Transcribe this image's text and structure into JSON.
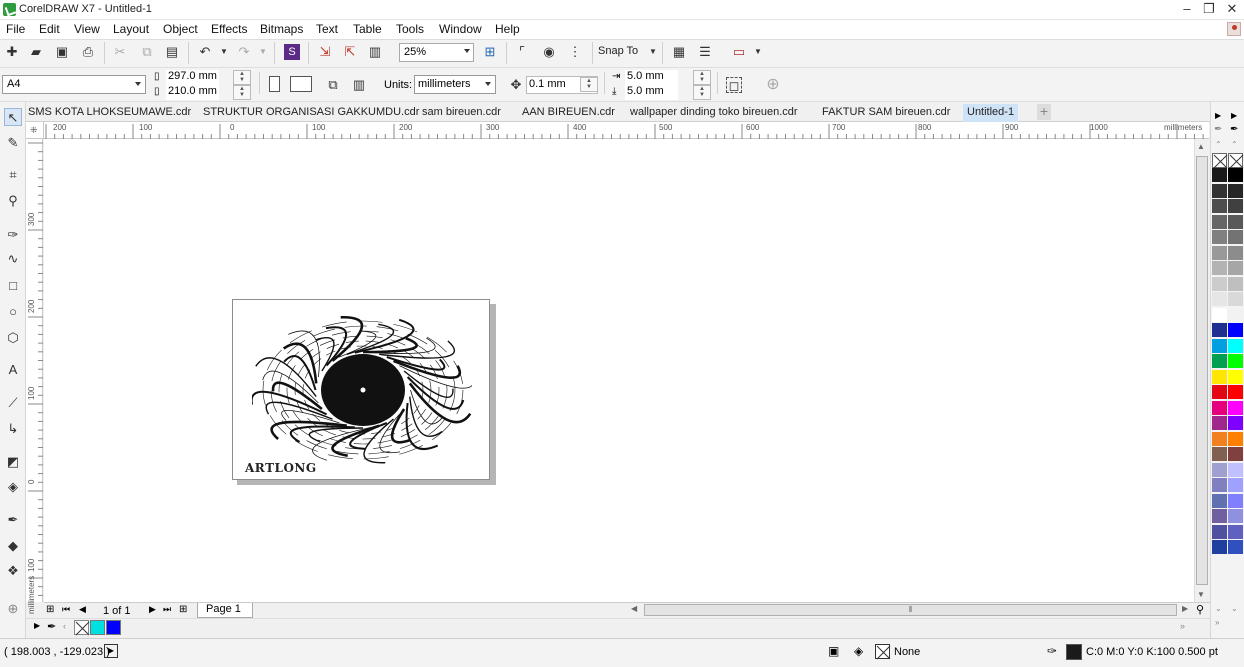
{
  "window": {
    "title": "CorelDRAW X7 - Untitled-1",
    "minimize": "–",
    "maximize": "❐",
    "close": "✕"
  },
  "menu": [
    "File",
    "Edit",
    "View",
    "Layout",
    "Object",
    "Effects",
    "Bitmaps",
    "Text",
    "Table",
    "Tools",
    "Window",
    "Help"
  ],
  "toolbar": {
    "zoom": "25%",
    "snap_to": "Snap To"
  },
  "property_bar": {
    "paper": "A4",
    "width": "297.0 mm",
    "height": "210.0 mm",
    "units_label": "Units:",
    "units": "millimeters",
    "nudge": "0.1 mm",
    "dup_x": "5.0 mm",
    "dup_y": "5.0 mm"
  },
  "tabs": [
    "SMS KOTA LHOKSEUMAWE.cdr",
    "STRUKTUR ORGANISASI GAKKUMDU.cdr",
    "sam bireuen.cdr",
    "AAN BIREUEN.cdr",
    "wallpaper dinding toko bireuen.cdr",
    "FAKTUR SAM bireuen.cdr",
    "Untitled-1"
  ],
  "ruler": {
    "h_labels": [
      "200",
      "100",
      "0",
      "100",
      "200",
      "300",
      "400",
      "500",
      "600",
      "700",
      "800",
      "900",
      "1000"
    ],
    "h_unit": "millimeters",
    "v_labels": [
      "300",
      "200",
      "100",
      "0",
      "100"
    ],
    "v_unit": "millimeters"
  },
  "page": {
    "brand_text": "ARTLONG"
  },
  "navigator": {
    "page_count": "1 of 1",
    "page_tab": "Page 1"
  },
  "palette": {
    "col1": [
      "#1a1a1a",
      "#333333",
      "#4d4d4d",
      "#666666",
      "#808080",
      "#999999",
      "#b3b3b3",
      "#cccccc",
      "#e6e6e6",
      "#ffffff",
      "#1f2f8f",
      "#00a0e0",
      "#00a050",
      "#ffe600",
      "#e30613",
      "#e6007e",
      "#a0288c",
      "#f08020",
      "#806050",
      "#a0a0d0",
      "#8080c0",
      "#6070b0",
      "#7060a0",
      "#5050a0",
      "#2040a0"
    ],
    "col2": [
      "#000000",
      "#262626",
      "#404040",
      "#595959",
      "#737373",
      "#8c8c8c",
      "#a6a6a6",
      "#bfbfbf",
      "#d9d9d9",
      "#f2f2f2",
      "#0000ff",
      "#00ffff",
      "#00ff00",
      "#ffff00",
      "#ff0000",
      "#ff00ff",
      "#8000ff",
      "#ff8000",
      "#804040",
      "#c0c0ff",
      "#a0a0ff",
      "#8080ff",
      "#9090e0",
      "#6060c0",
      "#3050c0"
    ]
  },
  "doc_palette": [
    "#ffffff",
    "#00e0e0",
    "#0000ff"
  ],
  "status": {
    "coords": "( 198.003 , -129.023 )",
    "fill": "None",
    "outline": "C:0 M:0 Y:0 K:100  0.500 pt"
  }
}
